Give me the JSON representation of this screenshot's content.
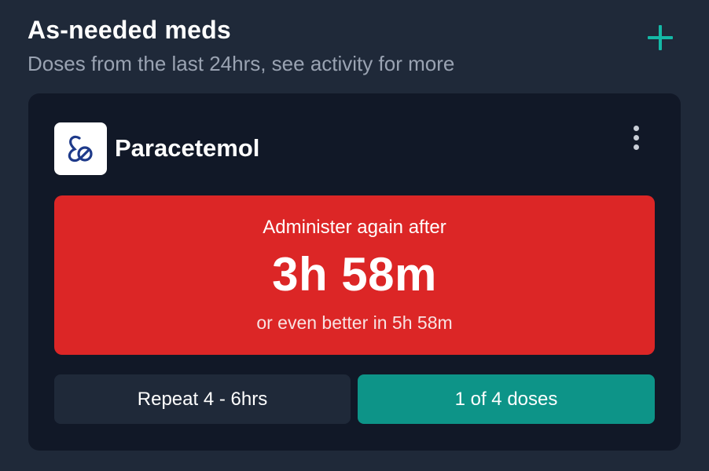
{
  "header": {
    "title": "As-needed meds",
    "subtitle": "Doses from the last 24hrs, see activity for more",
    "add_icon": "plus-icon"
  },
  "colors": {
    "background": "#1f2939",
    "card": "#111827",
    "alert": "#dc2626",
    "accent": "#0d9488",
    "secondary_button": "#1f2939"
  },
  "medication": {
    "name": "Paracetemol",
    "icon": "pills-icon",
    "menu_icon": "more-vertical-icon",
    "alert": {
      "label": "Administer again after",
      "time": "3h 58m",
      "note": "or even better in 5h 58m"
    },
    "repeat_label": "Repeat 4 - 6hrs",
    "doses_label": "1 of 4 doses"
  }
}
